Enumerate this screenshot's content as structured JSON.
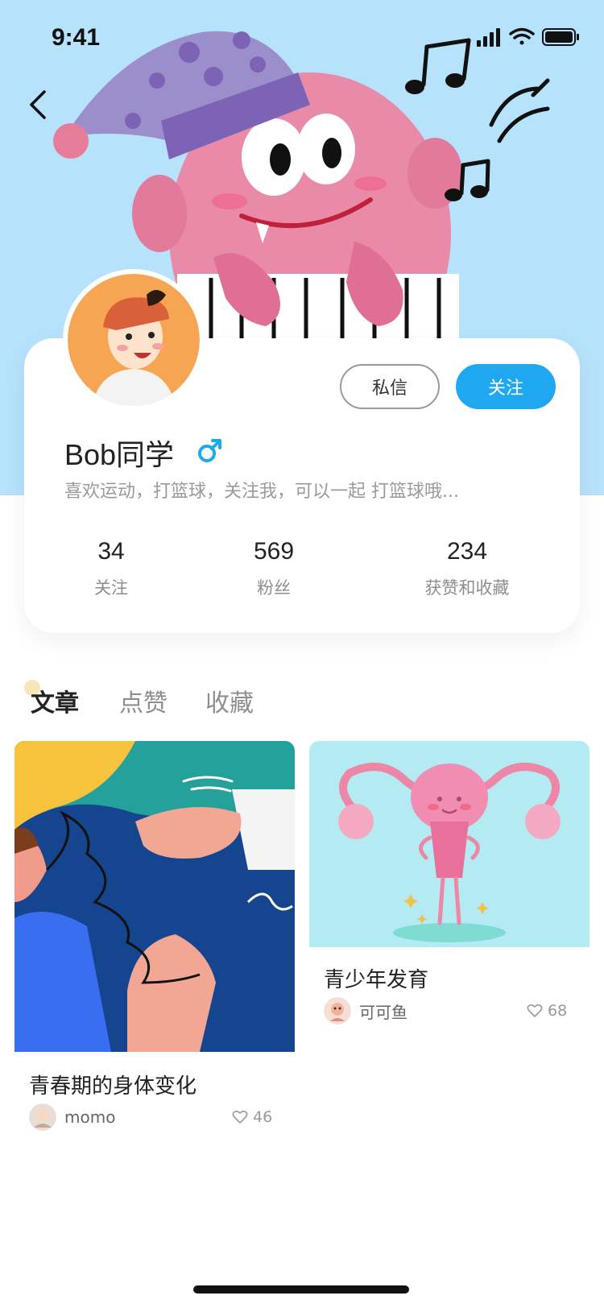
{
  "status": {
    "time": "9:41"
  },
  "profile": {
    "name": "Bob同学",
    "bio": "喜欢运动，打篮球，关注我，可以一起 打篮球哦...",
    "message_label": "私信",
    "follow_label": "关注",
    "stats": [
      {
        "value": "34",
        "label": "关注"
      },
      {
        "value": "569",
        "label": "粉丝"
      },
      {
        "value": "234",
        "label": "获赞和收藏"
      }
    ]
  },
  "tabs": [
    {
      "label": "文章",
      "active": true
    },
    {
      "label": "点赞",
      "active": false
    },
    {
      "label": "收藏",
      "active": false
    }
  ],
  "articles": [
    {
      "title": "青春期的身体变化",
      "author": "momo",
      "likes": "46"
    },
    {
      "title": "青少年发育",
      "author": "可可鱼",
      "likes": "68"
    }
  ],
  "colors": {
    "accent": "#1fa8f0",
    "hero_bg": "#b7e2fb"
  }
}
